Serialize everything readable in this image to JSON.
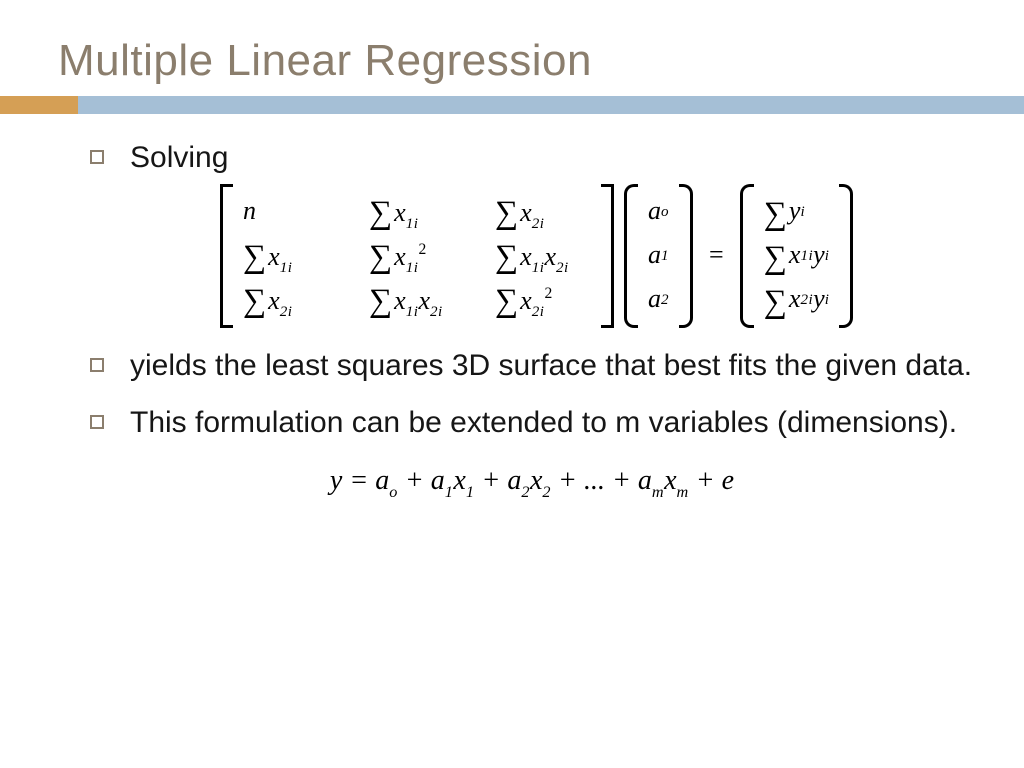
{
  "title": "Multiple Linear Regression",
  "bullets": {
    "b1": "Solving",
    "b2": "yields the least squares 3D surface that best fits the given data.",
    "b3": "This formulation can be extended to m variables (dimensions)."
  },
  "matrix": {
    "r1c1": "n",
    "r1c2_base": "x",
    "r1c2_sub": "1i",
    "r1c3_base": "x",
    "r1c3_sub": "2i",
    "r2c1_base": "x",
    "r2c1_sub": "1i",
    "r2c2_base": "x",
    "r2c2_sub": "1i",
    "r2c2_sup": "2",
    "r2c3_a_base": "x",
    "r2c3_a_sub": "1i",
    "r2c3_b_base": "x",
    "r2c3_b_sub": "2i",
    "r3c1_base": "x",
    "r3c1_sub": "2i",
    "r3c2_a_base": "x",
    "r3c2_a_sub": "1i",
    "r3c2_b_base": "x",
    "r3c2_b_sub": "2i",
    "r3c3_base": "x",
    "r3c3_sub": "2i",
    "r3c3_sup": "2"
  },
  "a_vec": {
    "a0_base": "a",
    "a0_sub": "o",
    "a1_base": "a",
    "a1_sub": "1",
    "a2_base": "a",
    "a2_sub": "2"
  },
  "rhs": {
    "r1_base": "y",
    "r1_sub": "i",
    "r2_a_base": "x",
    "r2_a_sub": "1i",
    "r2_b_base": "y",
    "r2_b_sub": "i",
    "r3_a_base": "x",
    "r3_a_sub": "2i",
    "r3_b_base": "y",
    "r3_b_sub": "i"
  },
  "formula2": {
    "text": "y = a",
    "t0_sub": "o",
    "plus": " + ",
    "a1": "a",
    "a1_sub": "1",
    "x1": "x",
    "x1_sub": "1",
    "a2": "a",
    "a2_sub": "2",
    "x2": "x",
    "x2_sub": "2",
    "dots": " + ... + ",
    "am": "a",
    "am_sub": "m",
    "xm": "x",
    "xm_sub": "m",
    "tail": " + e"
  },
  "glyphs": {
    "sum": "∑",
    "eq": "="
  }
}
